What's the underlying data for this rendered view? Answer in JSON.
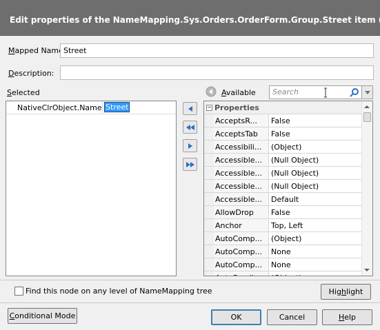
{
  "window": {
    "title": "Edit properties of the NameMapping.Sys.Orders.OrderForm.Group.Street item (Sys.Process(\"O"
  },
  "fields": {
    "mapped_name_label": "Mapped Name:",
    "mapped_name_value": "Street",
    "description_label": "Description:",
    "description_value": ""
  },
  "selected": {
    "label": "Selected",
    "rows": [
      {
        "name": "NativeClrObject.Name",
        "value": "Street"
      }
    ]
  },
  "available": {
    "label": "Available",
    "search_placeholder": "Search",
    "category": "Properties",
    "rows": [
      {
        "name": "AcceptsR...",
        "value": "False"
      },
      {
        "name": "AcceptsTab",
        "value": "False"
      },
      {
        "name": "Accessibili...",
        "value": "(Object)"
      },
      {
        "name": "Accessible...",
        "value": "(Null Object)"
      },
      {
        "name": "Accessible...",
        "value": "(Null Object)"
      },
      {
        "name": "Accessible...",
        "value": "(Null Object)"
      },
      {
        "name": "Accessible...",
        "value": "Default"
      },
      {
        "name": "AllowDrop",
        "value": "False"
      },
      {
        "name": "Anchor",
        "value": "Top, Left"
      },
      {
        "name": "AutoComp...",
        "value": "(Object)"
      },
      {
        "name": "AutoComp...",
        "value": "None"
      },
      {
        "name": "AutoComp...",
        "value": "None"
      },
      {
        "name": "AutoScroll",
        "value": "(Object)"
      }
    ]
  },
  "find_node_label": "Find this node on any level of NameMapping tree",
  "buttons": {
    "highlight": "Highlight",
    "conditional_mode": "Conditional Mode",
    "ok": "OK",
    "cancel": "Cancel",
    "help": "Help"
  },
  "colors": {
    "titlebar": "#6e6e6e",
    "selection": "#3399ff",
    "arrow_blue": "#2b6fc2"
  }
}
